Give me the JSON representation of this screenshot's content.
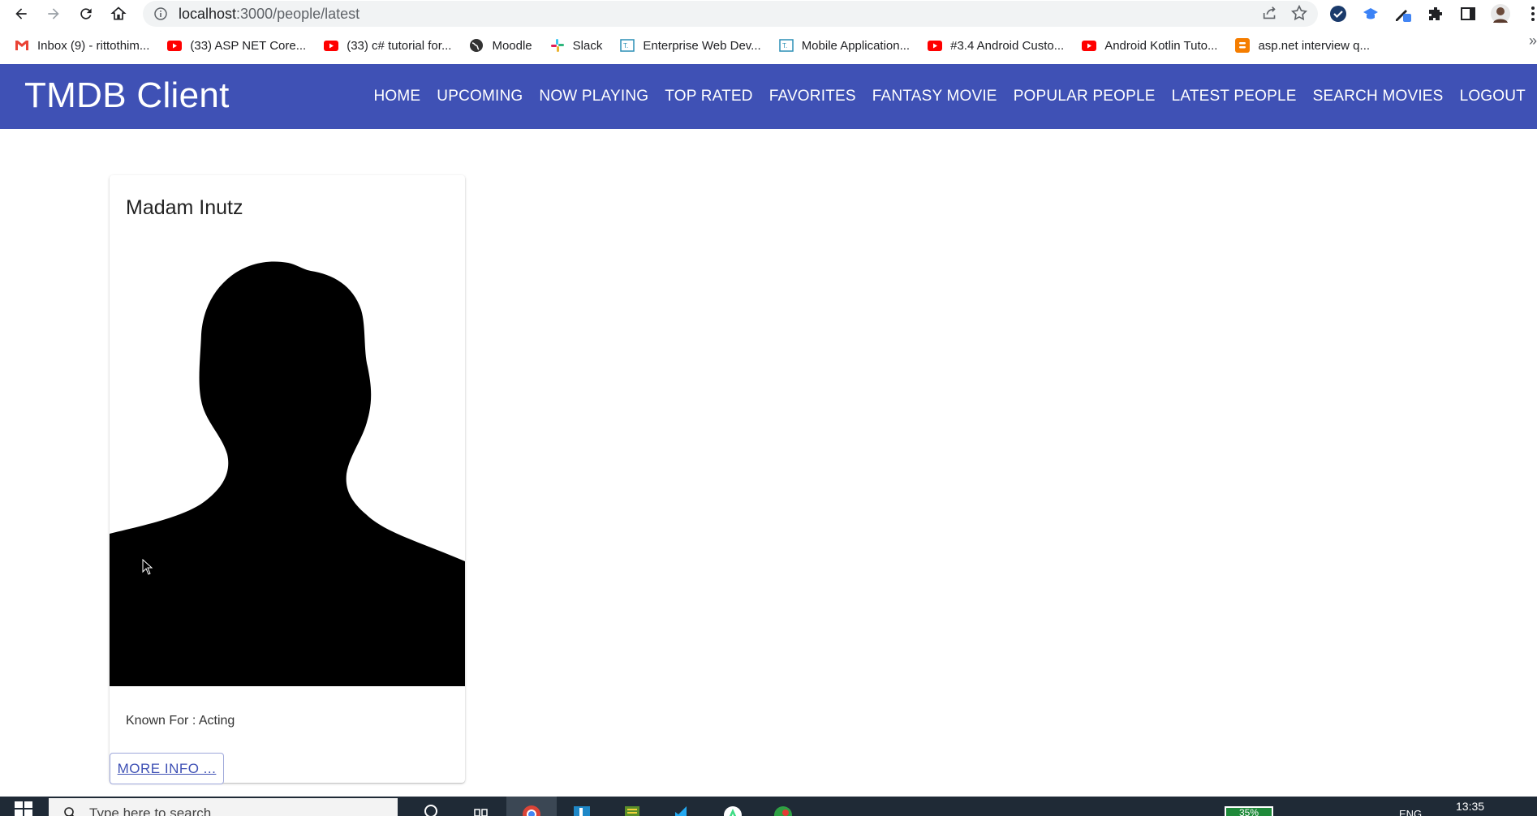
{
  "browser": {
    "url_host": "localhost",
    "url_path": ":3000/people/latest",
    "bookmarks": [
      {
        "label": "Inbox (9) - rittothim...",
        "icon": "gmail-icon"
      },
      {
        "label": "(33) ASP NET Core...",
        "icon": "youtube-icon"
      },
      {
        "label": "(33) c# tutorial for...",
        "icon": "youtube-icon"
      },
      {
        "label": "Moodle",
        "icon": "globe-icon"
      },
      {
        "label": "Slack",
        "icon": "slack-icon"
      },
      {
        "label": "Enterprise Web Dev...",
        "icon": "teams-icon"
      },
      {
        "label": "Mobile Application...",
        "icon": "teams-icon"
      },
      {
        "label": "#3.4 Android Custo...",
        "icon": "youtube-icon"
      },
      {
        "label": "Android Kotlin Tuto...",
        "icon": "youtube-icon"
      },
      {
        "label": "asp.net interview q...",
        "icon": "blogger-icon"
      }
    ],
    "more_bookmarks": "»"
  },
  "app": {
    "brand": "TMDB Client",
    "nav": [
      "HOME",
      "UPCOMING",
      "NOW PLAYING",
      "TOP RATED",
      "FAVORITES",
      "FANTASY MOVIE",
      "POPULAR PEOPLE",
      "LATEST PEOPLE",
      "SEARCH MOVIES",
      "LOGOUT"
    ],
    "primary_color": "#3f51b5"
  },
  "person_card": {
    "name": "Madam Inutz",
    "known_for": "Known For : Acting",
    "more_button": "MORE INFO ..."
  },
  "taskbar": {
    "search_placeholder": "Type here to search",
    "battery": "35%",
    "language": "ENG",
    "time": "13:35"
  }
}
